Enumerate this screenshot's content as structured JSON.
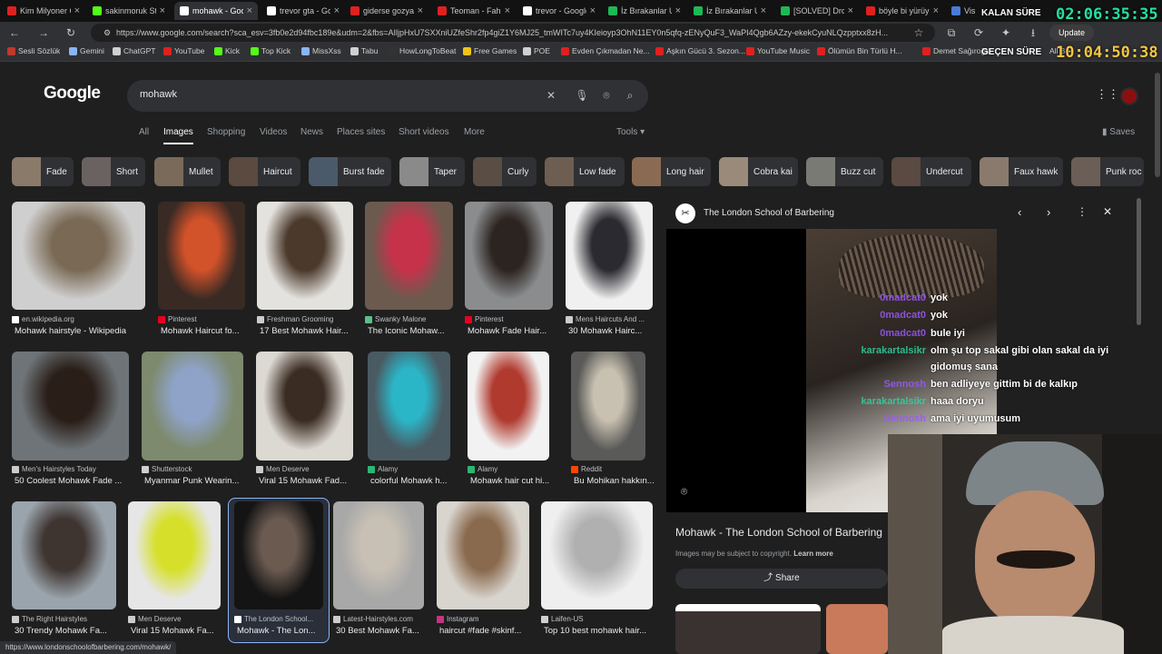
{
  "browser": {
    "tabs": [
      {
        "label": "Kim Milyoner Olmak İster",
        "color": "#e02020"
      },
      {
        "label": "sakinmoruk Stream",
        "color": "#53fc18"
      },
      {
        "label": "mohawk - Google",
        "color": "#ffffff"
      },
      {
        "label": "trevor gta - Google",
        "color": "#ffffff"
      },
      {
        "label": "giderse gozyasi",
        "color": "#e02020"
      },
      {
        "label": "Teoman - Fahişe",
        "color": "#e02020"
      },
      {
        "label": "trevor - Google",
        "color": "#ffffff"
      },
      {
        "label": "İz Bırakanlar Un",
        "color": "#1db954"
      },
      {
        "label": "İz Bırakanlar Un",
        "color": "#1db954"
      },
      {
        "label": "[SOLVED] Droid",
        "color": "#1db954"
      },
      {
        "label": "böyle bi yürüy",
        "color": "#e02020"
      },
      {
        "label": "Visa",
        "color": "#4a7bd8"
      }
    ],
    "url": "https://www.google.com/search?sca_esv=3fb0e2d94fbc189e&udm=2&fbs=AIljpHxU7SXXniUZfeShr2fp4giZ1Y6MJ25_tmWITc7uy4KIeioyp3OhN11EY0n5qfq-zENyQuF3_WaPI4Qgb6AZzy-ekekCyuNLQzpptxx8zH...",
    "update_label": "Update",
    "bookmarks": [
      {
        "label": "Sesli Sözlük",
        "color": "#c0392b"
      },
      {
        "label": "Gemini",
        "color": "#8ab4f8"
      },
      {
        "label": "ChatGPT",
        "color": "#d0d0d0"
      },
      {
        "label": "YouTube",
        "color": "#e02020"
      },
      {
        "label": "Kick",
        "color": "#53fc18"
      },
      {
        "label": "Top Kick",
        "color": "#53fc18"
      },
      {
        "label": "MissXss",
        "color": "#8ab4f8"
      },
      {
        "label": "Tabu",
        "color": "#d0d0d0"
      },
      {
        "label": "HowLongToBeat",
        "color": "#333333"
      },
      {
        "label": "Free Games",
        "color": "#f0c419"
      },
      {
        "label": "POE",
        "color": "#d0d0d0"
      },
      {
        "label": "Evden Çıkmadan Ne...",
        "color": "#e02020"
      },
      {
        "label": "Aşkın Gücü 3. Sezon...",
        "color": "#e02020"
      },
      {
        "label": "YouTube Music",
        "color": "#e02020"
      },
      {
        "label": "Ölümün Bin Türlü H...",
        "color": "#e02020"
      },
      {
        "label": "Demet Sağıroğlu",
        "color": "#e02020"
      }
    ],
    "bookmarks_overflow": "All B"
  },
  "google": {
    "logo": "Google",
    "query": "mohawk",
    "filters": [
      "All",
      "Images",
      "Shopping",
      "Videos",
      "News",
      "Places sites",
      "Short videos",
      "More"
    ],
    "active_filter": "Images",
    "tools_label": "Tools",
    "saves_label": "Saves",
    "chips": [
      "Fade",
      "Short",
      "Mullet",
      "Haircut",
      "Burst fade",
      "Taper",
      "Curly",
      "Low fade",
      "Long hair",
      "Cobra kai",
      "Buzz cut",
      "Undercut",
      "Faux hawk",
      "Punk roc"
    ]
  },
  "results": [
    {
      "source": "en.wikipedia.org",
      "title": "Mohawk hairstyle - Wikipedia",
      "src_color": "#ffffff",
      "colors": [
        "#cfcfcf",
        "#7a6a55"
      ]
    },
    {
      "source": "Pinterest",
      "title": "Mohawk Haircut fo...",
      "src_color": "#e60023",
      "colors": [
        "#3a2a24",
        "#d2522a"
      ]
    },
    {
      "source": "Freshman Grooming",
      "title": "17 Best Mohawk Hair...",
      "src_color": "#cccccc",
      "colors": [
        "#e4e2de",
        "#4b3a2c"
      ]
    },
    {
      "source": "Swanky Malone",
      "title": "The Iconic Mohaw...",
      "src_color": "#5bbf8a",
      "colors": [
        "#6c5a4e",
        "#c6324a"
      ]
    },
    {
      "source": "Pinterest",
      "title": "Mohawk Fade Hair...",
      "src_color": "#e60023",
      "colors": [
        "#8a8c8e",
        "#2c2420"
      ]
    },
    {
      "source": "Mens Haircuts And ...",
      "title": "30 Mohawk Hairc...",
      "src_color": "#cccccc",
      "colors": [
        "#f0f0f0",
        "#2a2a30"
      ]
    },
    {
      "source": "Men's Hairstyles Today",
      "title": "50 Coolest Mohawk Fade ...",
      "src_color": "#cccccc",
      "colors": [
        "#6e7478",
        "#2a1e18"
      ]
    },
    {
      "source": "Shutterstock",
      "title": "Myanmar Punk Wearin...",
      "src_color": "#d0d0d0",
      "colors": [
        "#7d8a6e",
        "#8fa3c8"
      ]
    },
    {
      "source": "Men Deserve",
      "title": "Viral 15 Mohawk Fad...",
      "src_color": "#cccccc",
      "colors": [
        "#dcd8d2",
        "#3a2c22"
      ]
    },
    {
      "source": "Alamy",
      "title": "colorful Mohawk h...",
      "src_color": "#2bb673",
      "colors": [
        "#4a5a62",
        "#2bb6c8"
      ]
    },
    {
      "source": "Alamy",
      "title": "Mohawk hair cut hi...",
      "src_color": "#2bb673",
      "colors": [
        "#f2f2f2",
        "#b03a2e"
      ]
    },
    {
      "source": "Reddit",
      "title": "Bu Mohikan hakkın...",
      "src_color": "#ff4500",
      "colors": [
        "#5a5a58",
        "#c8c0b0"
      ]
    },
    {
      "source": "The Right Hairstyles",
      "title": "30 Trendy Mohawk Fa...",
      "src_color": "#cccccc",
      "colors": [
        "#9aa4ac",
        "#3e3430"
      ]
    },
    {
      "source": "Men Deserve",
      "title": "Viral 15 Mohawk Fa...",
      "src_color": "#cccccc",
      "colors": [
        "#e6e6e6",
        "#d6e02a"
      ]
    },
    {
      "source": "The London School...",
      "title": "Mohawk - The Lon...",
      "src_color": "#ffffff",
      "colors": [
        "#141414",
        "#6a5a50"
      ]
    },
    {
      "source": "Latest-Hairstyles.com",
      "title": "30 Best Mohawk Fa...",
      "src_color": "#cccccc",
      "colors": [
        "#a8a8a8",
        "#c8c0b4"
      ]
    },
    {
      "source": "Instagram",
      "title": "haircut #fade #skinf...",
      "src_color": "#c13584",
      "colors": [
        "#d8d4ce",
        "#8a6a4e"
      ]
    },
    {
      "source": "Laifen-US",
      "title": "Top 10 best mohawk hair...",
      "src_color": "#d0d0d0",
      "colors": [
        "#efefef",
        "#b0b0b0"
      ]
    }
  ],
  "panel": {
    "site": "The London School of Barbering",
    "title": "Mohawk - The London School of Barbering",
    "copyright": "Images may be subject to copyright.",
    "learn_more": "Learn more",
    "share_label": "Share"
  },
  "chat": [
    {
      "user": "0madcat0",
      "message": "yok",
      "color": "#9b59ff"
    },
    {
      "user": "0madcat0",
      "message": "yok",
      "color": "#9b59ff"
    },
    {
      "user": "0madcat0",
      "message": "bule iyi",
      "color": "#9b59ff"
    },
    {
      "user": "karakartalsikr",
      "message": "olm şu top sakal gibi olan sakal da iyi",
      "color": "#2bd6a0"
    },
    {
      "user": "",
      "message": "gidomuş sana",
      "color": "#2bd6a0"
    },
    {
      "user": "Sennosh",
      "message": "ben adliyeye gittim bi de kalkıp",
      "color": "#9b59ff"
    },
    {
      "user": "karakartalsikr",
      "message": "haaa doryu",
      "color": "#2bd6a0"
    },
    {
      "user": "Sennosh",
      "message": "ama iyi uyumusum",
      "color": "#9b59ff"
    }
  ],
  "timers": {
    "remaining_label": "KALAN SÜRE",
    "remaining_value": "02:06:35:35",
    "elapsed_label": "GEÇEN SÜRE",
    "elapsed_value": "10:04:50:38"
  },
  "status_url": "https://www.londonschoolofbarbering.com/mohawk/"
}
